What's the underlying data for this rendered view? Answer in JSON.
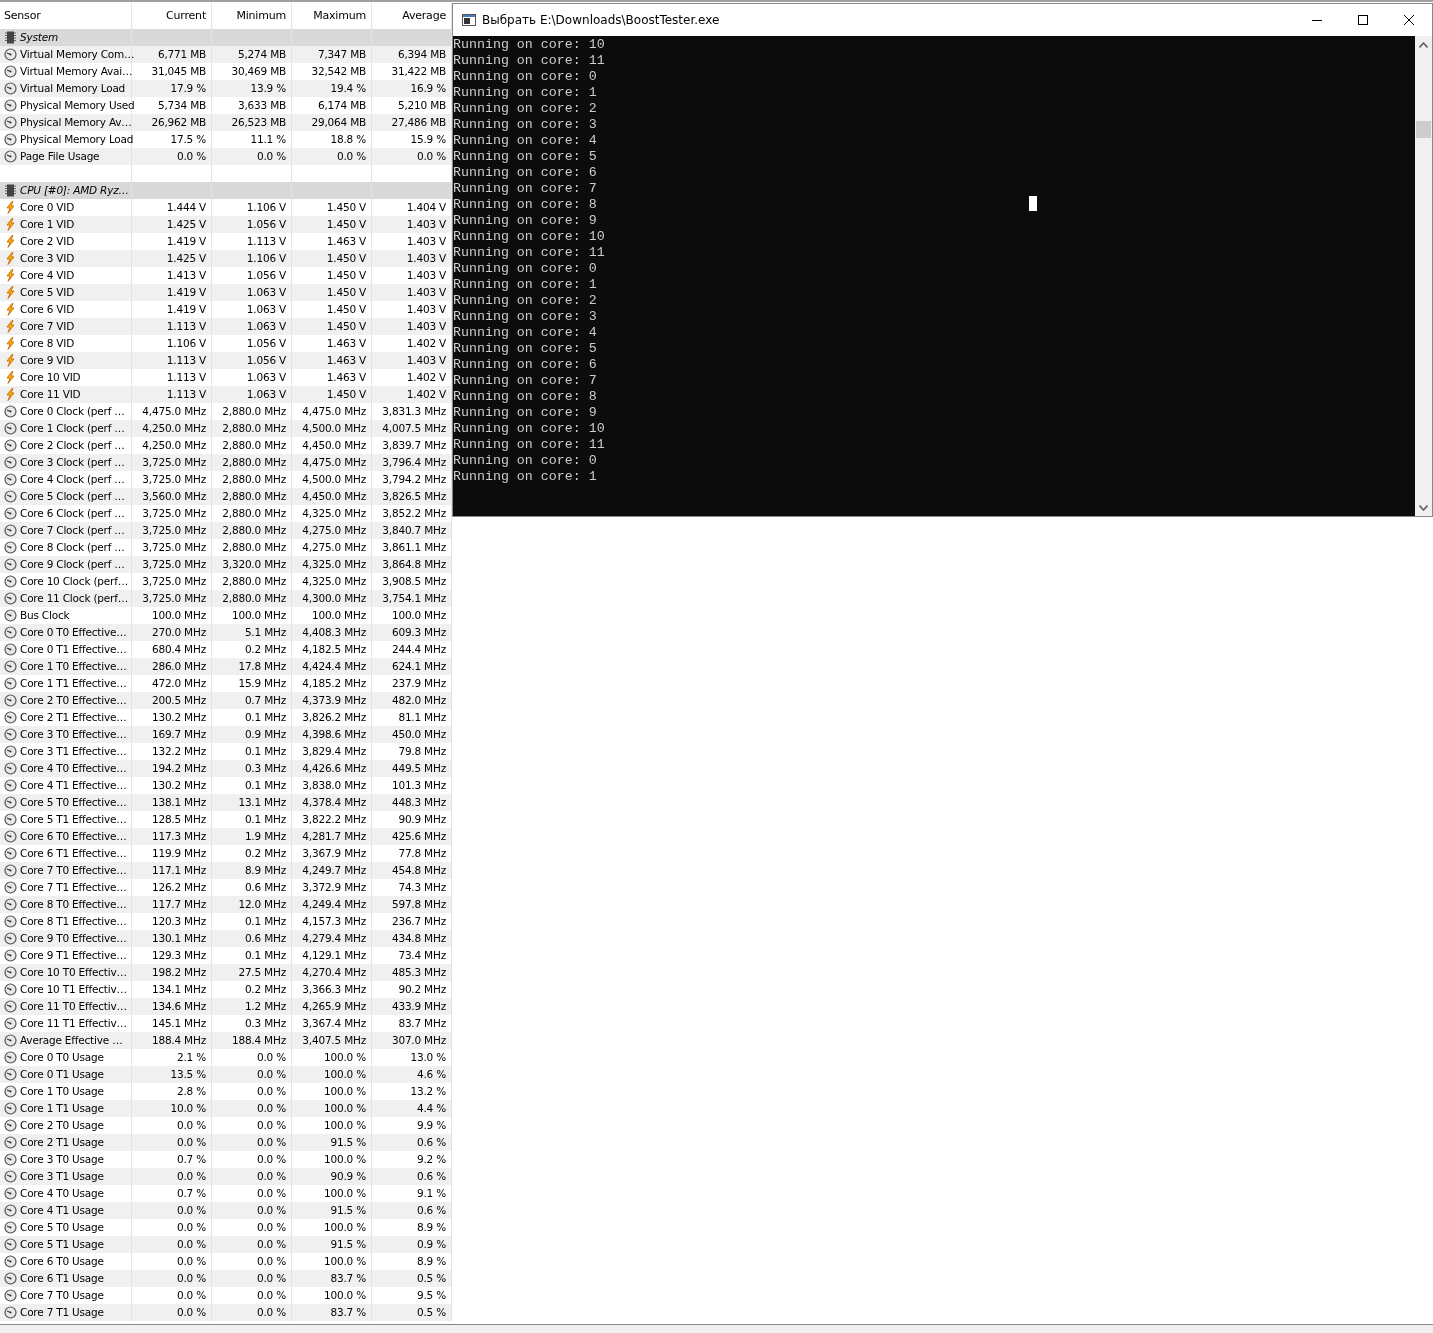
{
  "sensor_table": {
    "columns": [
      "Sensor",
      "Current",
      "Minimum",
      "Maximum",
      "Average"
    ],
    "rows": [
      {
        "kind": "group",
        "label": "System"
      },
      {
        "kind": "gauge",
        "cells": [
          "Virtual Memory Com…",
          "6,771 MB",
          "5,274 MB",
          "7,347 MB",
          "6,394 MB"
        ]
      },
      {
        "kind": "gauge",
        "cells": [
          "Virtual Memory Avai…",
          "31,045 MB",
          "30,469 MB",
          "32,542 MB",
          "31,422 MB"
        ]
      },
      {
        "kind": "gauge",
        "cells": [
          "Virtual Memory Load",
          "17.9 %",
          "13.9 %",
          "19.4 %",
          "16.9 %"
        ]
      },
      {
        "kind": "gauge",
        "cells": [
          "Physical Memory Used",
          "5,734 MB",
          "3,633 MB",
          "6,174 MB",
          "5,210 MB"
        ]
      },
      {
        "kind": "gauge",
        "cells": [
          "Physical Memory Av…",
          "26,962 MB",
          "26,523 MB",
          "29,064 MB",
          "27,486 MB"
        ]
      },
      {
        "kind": "gauge",
        "cells": [
          "Physical Memory Load",
          "17.5 %",
          "11.1 %",
          "18.8 %",
          "15.9 %"
        ]
      },
      {
        "kind": "gauge",
        "cells": [
          "Page File Usage",
          "0.0 %",
          "0.0 %",
          "0.0 %",
          "0.0 %"
        ]
      },
      {
        "kind": "blank"
      },
      {
        "kind": "group",
        "label": "CPU [#0]: AMD Ryz…"
      },
      {
        "kind": "voltage",
        "cells": [
          "Core 0 VID",
          "1.444 V",
          "1.106 V",
          "1.450 V",
          "1.404 V"
        ]
      },
      {
        "kind": "voltage",
        "cells": [
          "Core 1 VID",
          "1.425 V",
          "1.056 V",
          "1.450 V",
          "1.403 V"
        ]
      },
      {
        "kind": "voltage",
        "cells": [
          "Core 2 VID",
          "1.419 V",
          "1.113 V",
          "1.463 V",
          "1.403 V"
        ]
      },
      {
        "kind": "voltage",
        "cells": [
          "Core 3 VID",
          "1.425 V",
          "1.106 V",
          "1.450 V",
          "1.403 V"
        ]
      },
      {
        "kind": "voltage",
        "cells": [
          "Core 4 VID",
          "1.413 V",
          "1.056 V",
          "1.450 V",
          "1.403 V"
        ]
      },
      {
        "kind": "voltage",
        "cells": [
          "Core 5 VID",
          "1.419 V",
          "1.063 V",
          "1.450 V",
          "1.403 V"
        ]
      },
      {
        "kind": "voltage",
        "cells": [
          "Core 6 VID",
          "1.419 V",
          "1.063 V",
          "1.450 V",
          "1.403 V"
        ]
      },
      {
        "kind": "voltage",
        "cells": [
          "Core 7 VID",
          "1.113 V",
          "1.063 V",
          "1.450 V",
          "1.403 V"
        ]
      },
      {
        "kind": "voltage",
        "cells": [
          "Core 8 VID",
          "1.106 V",
          "1.056 V",
          "1.463 V",
          "1.402 V"
        ]
      },
      {
        "kind": "voltage",
        "cells": [
          "Core 9 VID",
          "1.113 V",
          "1.056 V",
          "1.463 V",
          "1.403 V"
        ]
      },
      {
        "kind": "voltage",
        "cells": [
          "Core 10 VID",
          "1.113 V",
          "1.063 V",
          "1.463 V",
          "1.402 V"
        ]
      },
      {
        "kind": "voltage",
        "cells": [
          "Core 11 VID",
          "1.113 V",
          "1.063 V",
          "1.450 V",
          "1.402 V"
        ]
      },
      {
        "kind": "gauge",
        "cells": [
          "Core 0 Clock (perf …",
          "4,475.0 MHz",
          "2,880.0 MHz",
          "4,475.0 MHz",
          "3,831.3 MHz"
        ]
      },
      {
        "kind": "gauge",
        "cells": [
          "Core 1 Clock (perf …",
          "4,250.0 MHz",
          "2,880.0 MHz",
          "4,500.0 MHz",
          "4,007.5 MHz"
        ]
      },
      {
        "kind": "gauge",
        "cells": [
          "Core 2 Clock (perf …",
          "4,250.0 MHz",
          "2,880.0 MHz",
          "4,450.0 MHz",
          "3,839.7 MHz"
        ]
      },
      {
        "kind": "gauge",
        "cells": [
          "Core 3 Clock (perf …",
          "3,725.0 MHz",
          "2,880.0 MHz",
          "4,475.0 MHz",
          "3,796.4 MHz"
        ]
      },
      {
        "kind": "gauge",
        "cells": [
          "Core 4 Clock (perf …",
          "3,725.0 MHz",
          "2,880.0 MHz",
          "4,500.0 MHz",
          "3,794.2 MHz"
        ]
      },
      {
        "kind": "gauge",
        "cells": [
          "Core 5 Clock (perf …",
          "3,560.0 MHz",
          "2,880.0 MHz",
          "4,450.0 MHz",
          "3,826.5 MHz"
        ]
      },
      {
        "kind": "gauge",
        "cells": [
          "Core 6 Clock (perf …",
          "3,725.0 MHz",
          "2,880.0 MHz",
          "4,325.0 MHz",
          "3,852.2 MHz"
        ]
      },
      {
        "kind": "gauge",
        "cells": [
          "Core 7 Clock (perf …",
          "3,725.0 MHz",
          "2,880.0 MHz",
          "4,275.0 MHz",
          "3,840.7 MHz"
        ]
      },
      {
        "kind": "gauge",
        "cells": [
          "Core 8 Clock (perf …",
          "3,725.0 MHz",
          "2,880.0 MHz",
          "4,275.0 MHz",
          "3,861.1 MHz"
        ]
      },
      {
        "kind": "gauge",
        "cells": [
          "Core 9 Clock (perf …",
          "3,725.0 MHz",
          "3,320.0 MHz",
          "4,325.0 MHz",
          "3,864.8 MHz"
        ]
      },
      {
        "kind": "gauge",
        "cells": [
          "Core 10 Clock (perf…",
          "3,725.0 MHz",
          "2,880.0 MHz",
          "4,325.0 MHz",
          "3,908.5 MHz"
        ]
      },
      {
        "kind": "gauge",
        "cells": [
          "Core 11 Clock (perf…",
          "3,725.0 MHz",
          "2,880.0 MHz",
          "4,300.0 MHz",
          "3,754.1 MHz"
        ]
      },
      {
        "kind": "gauge",
        "cells": [
          "Bus Clock",
          "100.0 MHz",
          "100.0 MHz",
          "100.0 MHz",
          "100.0 MHz"
        ]
      },
      {
        "kind": "gauge",
        "cells": [
          "Core 0 T0 Effective…",
          "270.0 MHz",
          "5.1 MHz",
          "4,408.3 MHz",
          "609.3 MHz"
        ]
      },
      {
        "kind": "gauge",
        "cells": [
          "Core 0 T1 Effective…",
          "680.4 MHz",
          "0.2 MHz",
          "4,182.5 MHz",
          "244.4 MHz"
        ]
      },
      {
        "kind": "gauge",
        "cells": [
          "Core 1 T0 Effective…",
          "286.0 MHz",
          "17.8 MHz",
          "4,424.4 MHz",
          "624.1 MHz"
        ]
      },
      {
        "kind": "gauge",
        "cells": [
          "Core 1 T1 Effective…",
          "472.0 MHz",
          "15.9 MHz",
          "4,185.2 MHz",
          "237.9 MHz"
        ]
      },
      {
        "kind": "gauge",
        "cells": [
          "Core 2 T0 Effective…",
          "200.5 MHz",
          "0.7 MHz",
          "4,373.9 MHz",
          "482.0 MHz"
        ]
      },
      {
        "kind": "gauge",
        "cells": [
          "Core 2 T1 Effective…",
          "130.2 MHz",
          "0.1 MHz",
          "3,826.2 MHz",
          "81.1 MHz"
        ]
      },
      {
        "kind": "gauge",
        "cells": [
          "Core 3 T0 Effective…",
          "169.7 MHz",
          "0.9 MHz",
          "4,398.6 MHz",
          "450.0 MHz"
        ]
      },
      {
        "kind": "gauge",
        "cells": [
          "Core 3 T1 Effective…",
          "132.2 MHz",
          "0.1 MHz",
          "3,829.4 MHz",
          "79.8 MHz"
        ]
      },
      {
        "kind": "gauge",
        "cells": [
          "Core 4 T0 Effective…",
          "194.2 MHz",
          "0.3 MHz",
          "4,426.6 MHz",
          "449.5 MHz"
        ]
      },
      {
        "kind": "gauge",
        "cells": [
          "Core 4 T1 Effective…",
          "130.2 MHz",
          "0.1 MHz",
          "3,838.0 MHz",
          "101.3 MHz"
        ]
      },
      {
        "kind": "gauge",
        "cells": [
          "Core 5 T0 Effective…",
          "138.1 MHz",
          "13.1 MHz",
          "4,378.4 MHz",
          "448.3 MHz"
        ]
      },
      {
        "kind": "gauge",
        "cells": [
          "Core 5 T1 Effective…",
          "128.5 MHz",
          "0.1 MHz",
          "3,822.2 MHz",
          "90.9 MHz"
        ]
      },
      {
        "kind": "gauge",
        "cells": [
          "Core 6 T0 Effective…",
          "117.3 MHz",
          "1.9 MHz",
          "4,281.7 MHz",
          "425.6 MHz"
        ]
      },
      {
        "kind": "gauge",
        "cells": [
          "Core 6 T1 Effective…",
          "119.9 MHz",
          "0.2 MHz",
          "3,367.9 MHz",
          "77.8 MHz"
        ]
      },
      {
        "kind": "gauge",
        "cells": [
          "Core 7 T0 Effective…",
          "117.1 MHz",
          "8.9 MHz",
          "4,249.7 MHz",
          "454.8 MHz"
        ]
      },
      {
        "kind": "gauge",
        "cells": [
          "Core 7 T1 Effective…",
          "126.2 MHz",
          "0.6 MHz",
          "3,372.9 MHz",
          "74.3 MHz"
        ]
      },
      {
        "kind": "gauge",
        "cells": [
          "Core 8 T0 Effective…",
          "117.7 MHz",
          "12.0 MHz",
          "4,249.4 MHz",
          "597.8 MHz"
        ]
      },
      {
        "kind": "gauge",
        "cells": [
          "Core 8 T1 Effective…",
          "120.3 MHz",
          "0.1 MHz",
          "4,157.3 MHz",
          "236.7 MHz"
        ]
      },
      {
        "kind": "gauge",
        "cells": [
          "Core 9 T0 Effective…",
          "130.1 MHz",
          "0.6 MHz",
          "4,279.4 MHz",
          "434.8 MHz"
        ]
      },
      {
        "kind": "gauge",
        "cells": [
          "Core 9 T1 Effective…",
          "129.3 MHz",
          "0.1 MHz",
          "4,129.1 MHz",
          "73.4 MHz"
        ]
      },
      {
        "kind": "gauge",
        "cells": [
          "Core 10 T0 Effectiv…",
          "198.2 MHz",
          "27.5 MHz",
          "4,270.4 MHz",
          "485.3 MHz"
        ]
      },
      {
        "kind": "gauge",
        "cells": [
          "Core 10 T1 Effectiv…",
          "134.1 MHz",
          "0.2 MHz",
          "3,366.3 MHz",
          "90.2 MHz"
        ]
      },
      {
        "kind": "gauge",
        "cells": [
          "Core 11 T0 Effectiv…",
          "134.6 MHz",
          "1.2 MHz",
          "4,265.9 MHz",
          "433.9 MHz"
        ]
      },
      {
        "kind": "gauge",
        "cells": [
          "Core 11 T1 Effectiv…",
          "145.1 MHz",
          "0.3 MHz",
          "3,367.4 MHz",
          "83.7 MHz"
        ]
      },
      {
        "kind": "gauge",
        "cells": [
          "Average Effective …",
          "188.4 MHz",
          "188.4 MHz",
          "3,407.5 MHz",
          "307.0 MHz"
        ]
      },
      {
        "kind": "gauge",
        "cells": [
          "Core 0 T0 Usage",
          "2.1 %",
          "0.0 %",
          "100.0 %",
          "13.0 %"
        ]
      },
      {
        "kind": "gauge",
        "cells": [
          "Core 0 T1 Usage",
          "13.5 %",
          "0.0 %",
          "100.0 %",
          "4.6 %"
        ]
      },
      {
        "kind": "gauge",
        "cells": [
          "Core 1 T0 Usage",
          "2.8 %",
          "0.0 %",
          "100.0 %",
          "13.2 %"
        ]
      },
      {
        "kind": "gauge",
        "cells": [
          "Core 1 T1 Usage",
          "10.0 %",
          "0.0 %",
          "100.0 %",
          "4.4 %"
        ]
      },
      {
        "kind": "gauge",
        "cells": [
          "Core 2 T0 Usage",
          "0.0 %",
          "0.0 %",
          "100.0 %",
          "9.9 %"
        ]
      },
      {
        "kind": "gauge",
        "cells": [
          "Core 2 T1 Usage",
          "0.0 %",
          "0.0 %",
          "91.5 %",
          "0.6 %"
        ]
      },
      {
        "kind": "gauge",
        "cells": [
          "Core 3 T0 Usage",
          "0.7 %",
          "0.0 %",
          "100.0 %",
          "9.2 %"
        ]
      },
      {
        "kind": "gauge",
        "cells": [
          "Core 3 T1 Usage",
          "0.0 %",
          "0.0 %",
          "90.9 %",
          "0.6 %"
        ]
      },
      {
        "kind": "gauge",
        "cells": [
          "Core 4 T0 Usage",
          "0.7 %",
          "0.0 %",
          "100.0 %",
          "9.1 %"
        ]
      },
      {
        "kind": "gauge",
        "cells": [
          "Core 4 T1 Usage",
          "0.0 %",
          "0.0 %",
          "91.5 %",
          "0.6 %"
        ]
      },
      {
        "kind": "gauge",
        "cells": [
          "Core 5 T0 Usage",
          "0.0 %",
          "0.0 %",
          "100.0 %",
          "8.9 %"
        ]
      },
      {
        "kind": "gauge",
        "cells": [
          "Core 5 T1 Usage",
          "0.0 %",
          "0.0 %",
          "91.5 %",
          "0.9 %"
        ]
      },
      {
        "kind": "gauge",
        "cells": [
          "Core 6 T0 Usage",
          "0.0 %",
          "0.0 %",
          "100.0 %",
          "8.9 %"
        ]
      },
      {
        "kind": "gauge",
        "cells": [
          "Core 6 T1 Usage",
          "0.0 %",
          "0.0 %",
          "83.7 %",
          "0.5 %"
        ]
      },
      {
        "kind": "gauge",
        "cells": [
          "Core 7 T0 Usage",
          "0.0 %",
          "0.0 %",
          "100.0 %",
          "9.5 %"
        ]
      },
      {
        "kind": "gauge",
        "cells": [
          "Core 7 T1 Usage",
          "0.0 %",
          "0.0 %",
          "83.7 %",
          "0.5 %"
        ]
      }
    ]
  },
  "console_window": {
    "title": "Выбрать E:\\Downloads\\BoostTester.exe",
    "lines": [
      "Running on core: 10",
      "Running on core: 11",
      "Running on core: 0",
      "Running on core: 1",
      "Running on core: 2",
      "Running on core: 3",
      "Running on core: 4",
      "Running on core: 5",
      "Running on core: 6",
      "Running on core: 7",
      "Running on core: 8",
      "Running on core: 9",
      "Running on core: 10",
      "Running on core: 11",
      "Running on core: 0",
      "Running on core: 1",
      "Running on core: 2",
      "Running on core: 3",
      "Running on core: 4",
      "Running on core: 5",
      "Running on core: 6",
      "Running on core: 7",
      "Running on core: 8",
      "Running on core: 9",
      "Running on core: 10",
      "Running on core: 11",
      "Running on core: 0",
      "Running on core: 1"
    ]
  }
}
